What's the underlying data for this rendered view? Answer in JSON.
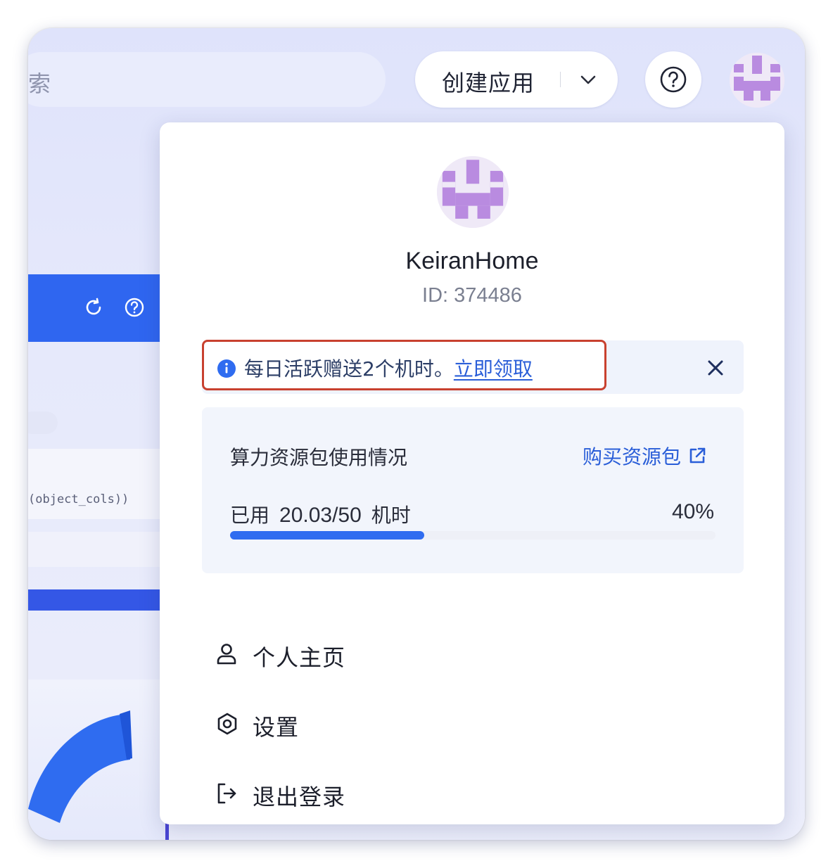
{
  "header": {
    "search_hint": "索",
    "create_button_label": "创建应用",
    "help_icon": "question-circle-icon",
    "avatar_icon": "pixel-avatar-icon"
  },
  "background_app": {
    "code_snippet": "(object_cols))",
    "icons": [
      "refresh-icon",
      "question-circle-icon"
    ]
  },
  "popover": {
    "username": "KeiranHome",
    "user_id": "ID: 374486",
    "notice": {
      "text": "每日活跃赠送2个机时。",
      "link": "立即领取",
      "icon": "info-icon",
      "close_icon": "close-icon"
    },
    "usage": {
      "title": "算力资源包使用情况",
      "buy_link": "购买资源包",
      "used_prefix": "已用",
      "used_value": "20.03/50",
      "used_unit": "机时",
      "percent_label": "40%",
      "progress_fraction": 0.4
    },
    "menu": [
      {
        "label": "个人主页",
        "icon": "user-icon"
      },
      {
        "label": "设置",
        "icon": "settings-hexagon-icon"
      },
      {
        "label": "退出登录",
        "icon": "logout-icon"
      }
    ]
  },
  "colors": {
    "accent": "#2f6cf0",
    "link": "#2a5ed8",
    "highlight_border": "#c8412f",
    "avatar_purple": "#b98be0"
  }
}
